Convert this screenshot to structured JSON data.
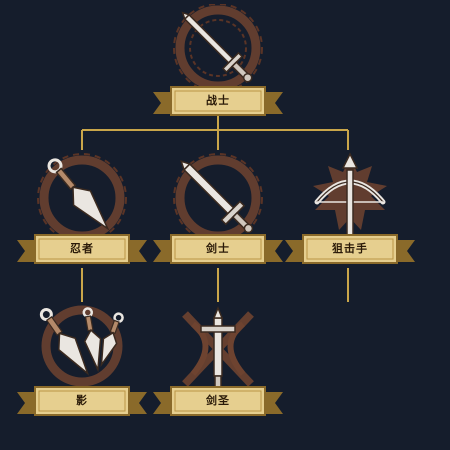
{
  "colors": {
    "background": "#151d2c",
    "connector": "#c9a64a",
    "banner_fill": "#e6cf8f",
    "banner_dark": "#8a6a2a",
    "emblem_bronze": "#7a4a32",
    "emblem_steel": "#e8e4df"
  },
  "skill_tree": {
    "root": {
      "label": "战士",
      "icon": "sword-emblem-icon"
    },
    "tier2": [
      {
        "label": "忍者",
        "icon": "kunai-emblem-icon"
      },
      {
        "label": "剑士",
        "icon": "sword-emblem-icon"
      },
      {
        "label": "狙击手",
        "icon": "crossbow-emblem-icon"
      }
    ],
    "tier3": [
      {
        "label": "影",
        "icon": "triple-kunai-emblem-icon"
      },
      {
        "label": "剑圣",
        "icon": "crossed-greatsword-emblem-icon"
      }
    ]
  }
}
